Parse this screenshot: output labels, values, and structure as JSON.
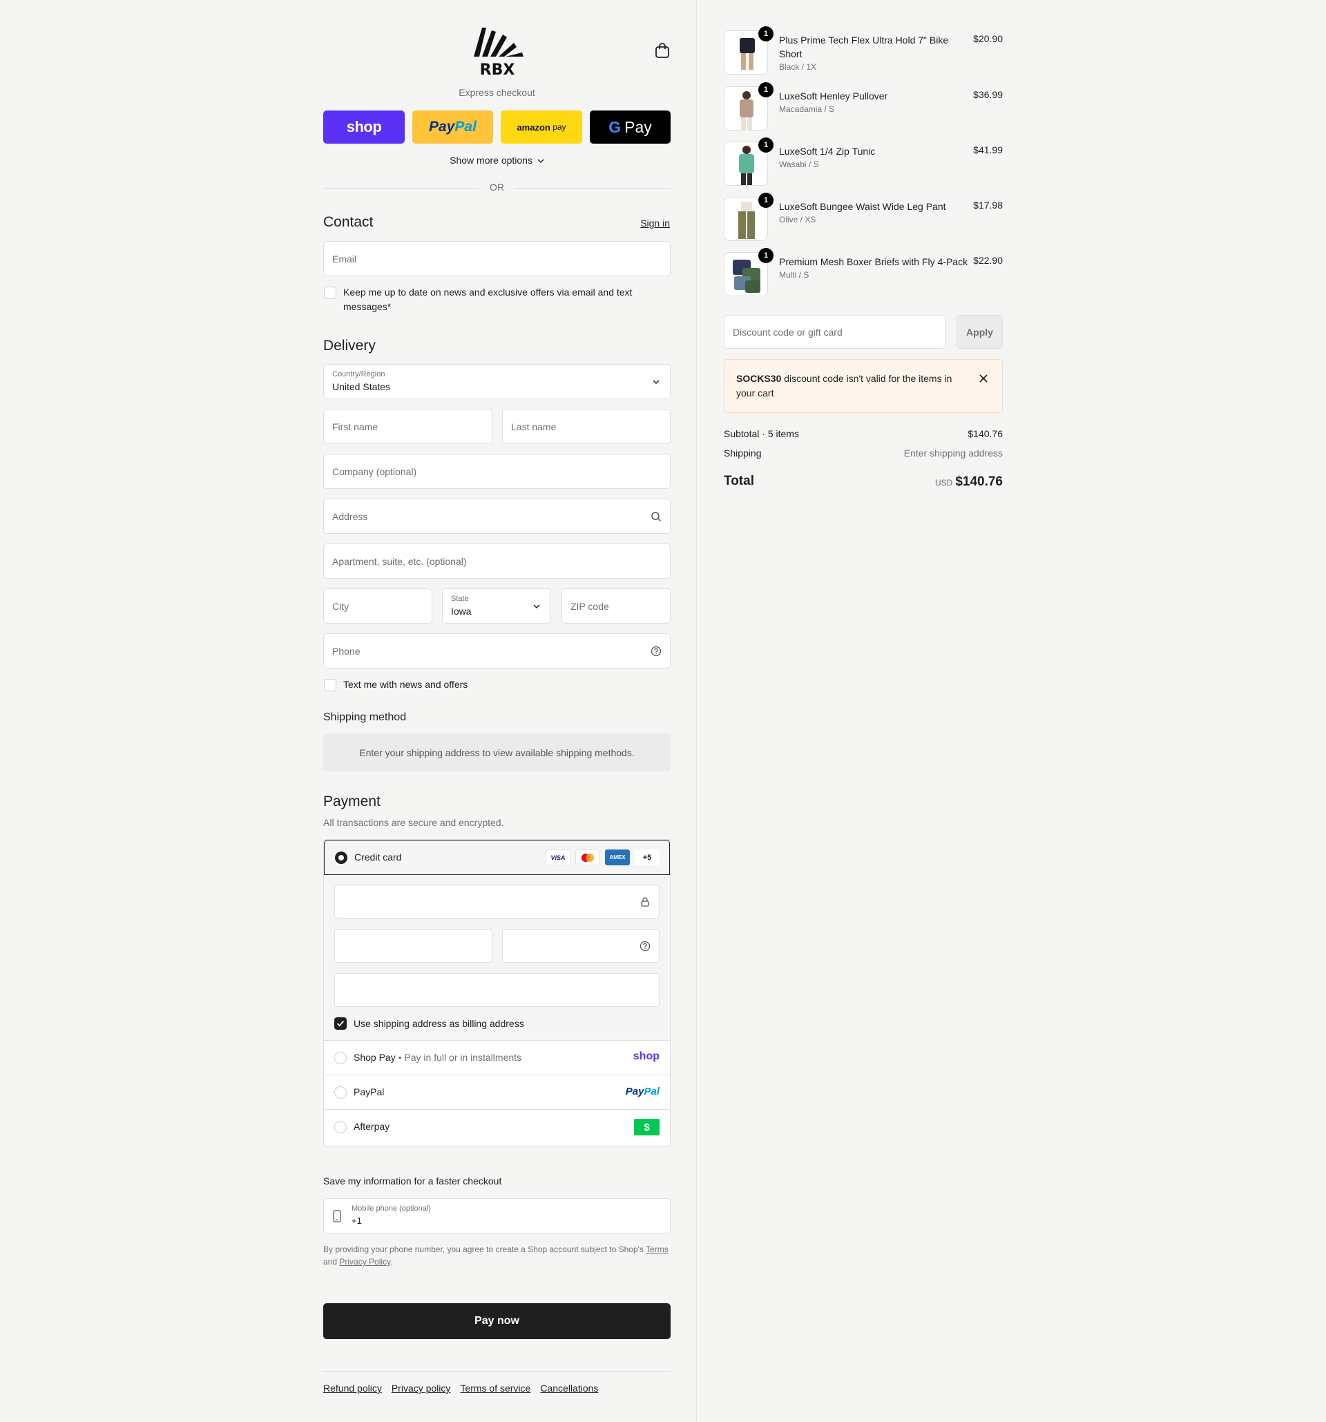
{
  "brand": {
    "logo_text": "RBX"
  },
  "express": {
    "label": "Express checkout",
    "shop_pay": "shop",
    "paypal_a": "Pay",
    "paypal_b": "Pal",
    "amazon_pay_a": "amazon",
    "amazon_pay_b": "pay",
    "google_pay_g": "G",
    "google_pay": "Pay",
    "more_options": "Show more options",
    "or": "OR"
  },
  "contact": {
    "title": "Contact",
    "sign_in": "Sign in",
    "email_placeholder": "Email",
    "newsletter_label": "Keep me up to date on news and exclusive offers via email and text messages*"
  },
  "delivery": {
    "title": "Delivery",
    "country_label": "Country/Region",
    "country_value": "United States",
    "first_name": "First name",
    "last_name": "Last name",
    "company": "Company (optional)",
    "address": "Address",
    "apartment": "Apartment, suite, etc. (optional)",
    "city": "City",
    "state_label": "State",
    "state_value": "Iowa",
    "zip": "ZIP code",
    "phone": "Phone",
    "sms_label": "Text me with news and offers"
  },
  "shipping_method": {
    "title": "Shipping method",
    "note": "Enter your shipping address to view available shipping methods."
  },
  "payment": {
    "title": "Payment",
    "subtitle": "All transactions are secure and encrypted.",
    "credit_card": "Credit card",
    "cards": [
      "VISA",
      "",
      "AMEX",
      "+5"
    ],
    "billing_same": "Use shipping address as billing address",
    "shop_pay_label": "Shop Pay",
    "shop_pay_desc": "Pay in full or in installments",
    "shop_pay_logo": "shop",
    "paypal_label": "PayPal",
    "paypal_logo_a": "Pay",
    "paypal_logo_b": "Pal",
    "afterpay_label": "Afterpay",
    "afterpay_logo": "$"
  },
  "save_info": {
    "title": "Save my information for a faster checkout",
    "mobile_label": "Mobile phone (optional)",
    "mobile_value": "+1",
    "disclaimer_a": "By providing your phone number, you agree to create a Shop account subject to Shop's",
    "terms": "Terms",
    "disclaimer_b": "and",
    "privacy": "Privacy Policy",
    "period": "."
  },
  "pay_now": "Pay now",
  "footer": [
    "Refund policy",
    "Privacy policy",
    "Terms of service",
    "Cancellations"
  ],
  "cart": {
    "items": [
      {
        "name": "Plus Prime Tech Flex Ultra Hold 7\" Bike Short",
        "variant": "Black / 1X",
        "price": "$20.90",
        "qty": "1"
      },
      {
        "name": "LuxeSoft Henley Pullover",
        "variant": "Macadamia / S",
        "price": "$36.99",
        "qty": "1"
      },
      {
        "name": "LuxeSoft 1/4 Zip Tunic",
        "variant": "Wasabi / S",
        "price": "$41.99",
        "qty": "1"
      },
      {
        "name": "LuxeSoft Bungee Waist Wide Leg Pant",
        "variant": "Olive / XS",
        "price": "$17.98",
        "qty": "1"
      },
      {
        "name": "Premium Mesh Boxer Briefs with Fly 4-Pack",
        "variant": "Multi / S",
        "price": "$22.90",
        "qty": "1"
      }
    ],
    "discount_placeholder": "Discount code or gift card",
    "apply": "Apply",
    "error_code": "SOCKS30",
    "error_text": " discount code isn't valid for the items in your cart",
    "subtotal_label": "Subtotal · 5 items",
    "subtotal_value": "$140.76",
    "shipping_label": "Shipping",
    "shipping_value": "Enter shipping address",
    "total_label": "Total",
    "currency": "USD",
    "total_value": "$140.76"
  },
  "colors": {
    "shop_purple": "#5a31f4",
    "paypal_yellow": "#ffc439",
    "amazon_yellow": "#ffd814",
    "primary_dark": "#1f1f1f",
    "error_bg": "#fff4ec",
    "afterpay_green": "#00c853"
  }
}
